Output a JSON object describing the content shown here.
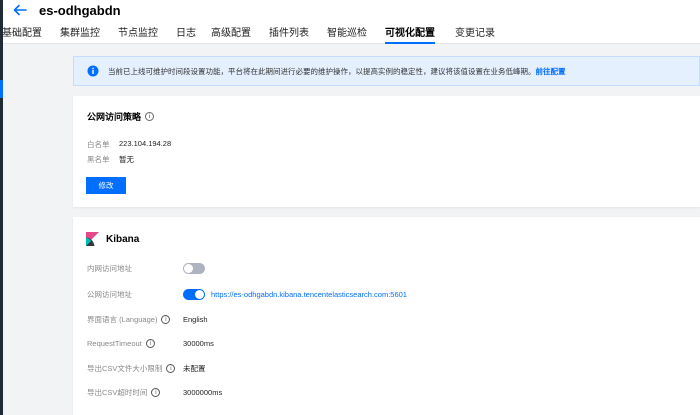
{
  "header": {
    "title": "es-odhgabdn",
    "tabs": [
      {
        "label": "基础配置"
      },
      {
        "label": "集群监控"
      },
      {
        "label": "节点监控"
      },
      {
        "label": "日志"
      },
      {
        "label": "高级配置"
      },
      {
        "label": "插件列表"
      },
      {
        "label": "智能巡检"
      },
      {
        "label": "可视化配置",
        "active": true
      },
      {
        "label": "变更记录"
      }
    ]
  },
  "notice": {
    "text": "当前已上线可维护时间段设置功能，平台将在此期间进行必要的维护操作，以提高实例的稳定性，建议将该值设置在业务低峰期。",
    "link": "前往配置"
  },
  "public_access": {
    "title": "公网访问策略",
    "whitelist_label": "白名单",
    "whitelist_value": "223.104.194.28",
    "blacklist_label": "黑名单",
    "blacklist_value": "暂无",
    "modify_button": "修改"
  },
  "kibana": {
    "title": "Kibana",
    "rows": {
      "private_access": {
        "label": "内网访问地址",
        "enabled": false
      },
      "public_access": {
        "label": "公网访问地址",
        "enabled": true,
        "value": "https://es-odhgabdn.kibana.tencentelasticsearch.com:5601"
      },
      "language": {
        "label": "界面语言 (Language)",
        "value": "English"
      },
      "request_timeout": {
        "label": "RequestTimeout",
        "value": "30000ms"
      },
      "csv_size": {
        "label": "导出CSV文件大小限制",
        "value": "未配置"
      },
      "csv_timeout": {
        "label": "导出CSV超时时间",
        "value": "3000000ms"
      }
    }
  },
  "colors": {
    "accent": "#006eff",
    "notice_bg": "#e5f0ff",
    "kibana_pink": "#e8488b",
    "kibana_dark": "#343741"
  },
  "icons": {
    "back": "arrow-left-icon",
    "notice": "info-icon",
    "help": "question-circle-icon",
    "kibana": "kibana-logo-icon"
  }
}
